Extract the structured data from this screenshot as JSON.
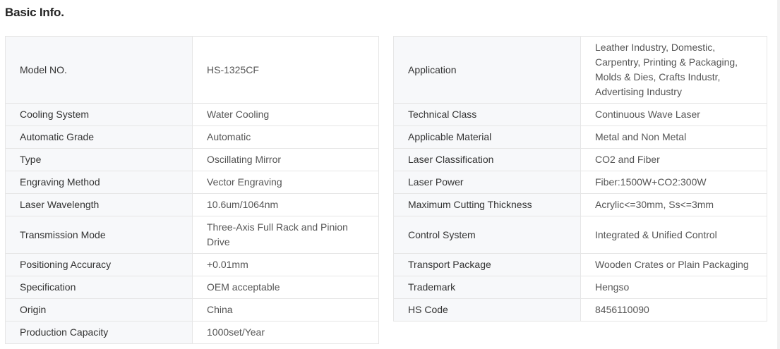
{
  "header": {
    "title": "Basic Info."
  },
  "left_table": {
    "rows": [
      {
        "label": "Model NO.",
        "value": "HS-1325CF"
      },
      {
        "label": "Cooling System",
        "value": "Water Cooling"
      },
      {
        "label": "Automatic Grade",
        "value": "Automatic"
      },
      {
        "label": "Type",
        "value": "Oscillating Mirror"
      },
      {
        "label": "Engraving Method",
        "value": "Vector Engraving"
      },
      {
        "label": "Laser Wavelength",
        "value": "10.6um/1064nm"
      },
      {
        "label": "Transmission Mode",
        "value": "Three-Axis Full Rack and Pinion Drive"
      },
      {
        "label": "Positioning Accuracy",
        "value": "+0.01mm"
      },
      {
        "label": "Specification",
        "value": "OEM acceptable"
      },
      {
        "label": "Origin",
        "value": "China"
      },
      {
        "label": "Production Capacity",
        "value": "1000set/Year"
      }
    ]
  },
  "right_table": {
    "rows": [
      {
        "label": "Application",
        "value": "Leather Industry, Domestic, Carpentry, Printing & Packaging, Molds & Dies, Crafts Industr, Advertising Industry"
      },
      {
        "label": "Technical Class",
        "value": "Continuous Wave Laser"
      },
      {
        "label": "Applicable Material",
        "value": "Metal and Non Metal"
      },
      {
        "label": "Laser Classification",
        "value": "CO2 and Fiber"
      },
      {
        "label": "Laser Power",
        "value": "Fiber:1500W+CO2:300W"
      },
      {
        "label": "Maximum Cutting Thickness",
        "value": "Acrylic<=30mm, Ss<=3mm"
      },
      {
        "label": "Control System",
        "value": "Integrated & Unified Control"
      },
      {
        "label": "Transport Package",
        "value": "Wooden Crates or Plain Packaging"
      },
      {
        "label": "Trademark",
        "value": "Hengso"
      },
      {
        "label": "HS Code",
        "value": "8456110090"
      }
    ]
  }
}
